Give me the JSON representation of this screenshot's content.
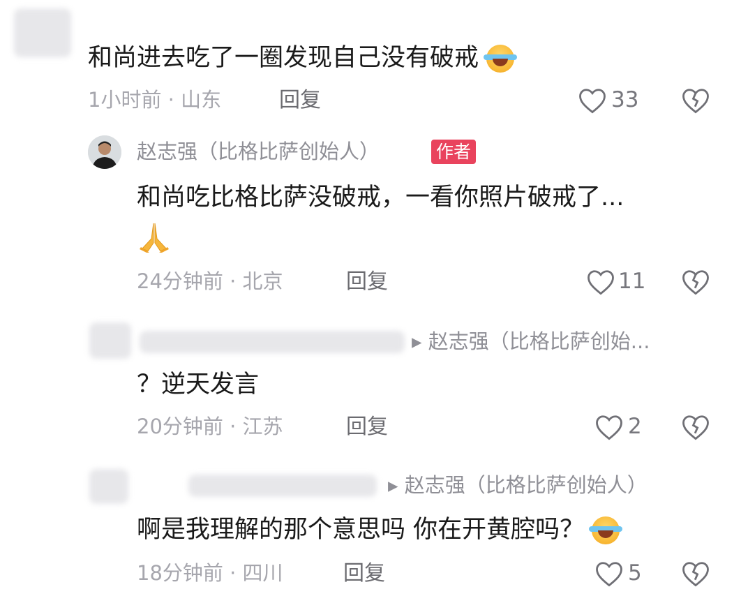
{
  "comments": [
    {
      "content": "和尚进去吃了一圈发现自己没有破戒",
      "emoji": "laugh-cry-emoji",
      "meta": "1小时前 · 山东",
      "reply_label": "回复",
      "likes": "33"
    },
    {
      "username": "赵志强（比格比萨创始人）",
      "badge": "作者",
      "content": "和尚吃比格比萨没破戒，一看你照片破戒了...",
      "emoji": "folded-hands-emoji",
      "meta": "24分钟前 · 北京",
      "reply_label": "回复",
      "likes": "11"
    },
    {
      "reply_to": "▸ 赵志强（比格比萨创始...",
      "content": "？逆天发言",
      "meta": "20分钟前 · 江苏",
      "reply_label": "回复",
      "likes": "2"
    },
    {
      "reply_to": "▸ 赵志强（比格比萨创始人）",
      "content": "啊是我理解的那个意思吗 你在开黄腔吗？",
      "emoji": "laugh-cry-emoji",
      "meta": "18分钟前 · 四川",
      "reply_label": "回复",
      "likes": "5"
    }
  ],
  "colors": {
    "badge": "#e9435d",
    "meta": "#a6a6ad",
    "content": "#1a1a1a"
  }
}
